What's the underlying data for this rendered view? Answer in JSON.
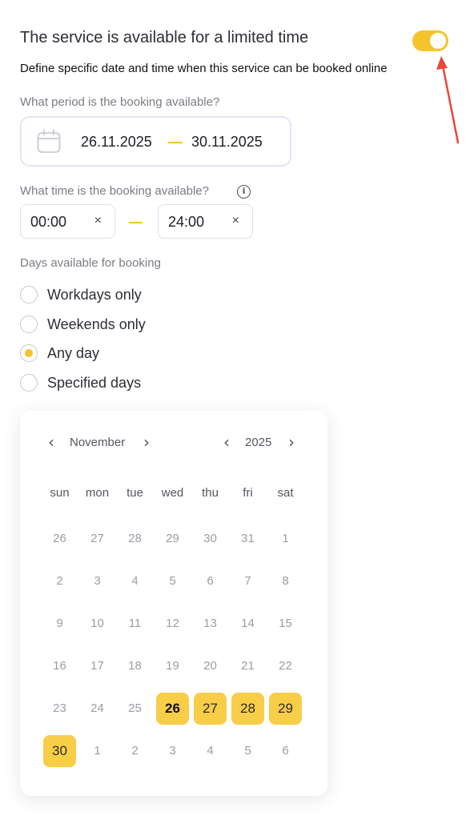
{
  "header": {
    "title": "The service is available for a limited time",
    "subtitle": "Define specific date and time when this service can be booked online",
    "toggle_on": true
  },
  "period": {
    "label": "What period is the booking available?",
    "start": "26.11.2025",
    "end": "30.11.2025",
    "icon": "calendar-icon"
  },
  "time": {
    "label": "What time is the booking available?",
    "info_icon": "i",
    "start": "00:00",
    "end": "24:00",
    "clear_symbol": "×"
  },
  "days": {
    "label": "Days available for booking",
    "options": [
      {
        "label": "Workdays only",
        "selected": false
      },
      {
        "label": "Weekends only",
        "selected": false
      },
      {
        "label": "Any day",
        "selected": true
      },
      {
        "label": "Specified days",
        "selected": false
      }
    ]
  },
  "calendar": {
    "month": "November",
    "year": "2025",
    "prev_symbol": "‹",
    "next_symbol": "›",
    "weekdays": [
      "sun",
      "mon",
      "tue",
      "wed",
      "thu",
      "fri",
      "sat"
    ],
    "weeks": [
      [
        "26",
        "27",
        "28",
        "29",
        "30",
        "31",
        "1"
      ],
      [
        "2",
        "3",
        "4",
        "5",
        "6",
        "7",
        "8"
      ],
      [
        "9",
        "10",
        "11",
        "12",
        "13",
        "14",
        "15"
      ],
      [
        "16",
        "17",
        "18",
        "19",
        "20",
        "21",
        "22"
      ],
      [
        "23",
        "24",
        "25",
        "26",
        "27",
        "28",
        "29"
      ],
      [
        "30",
        "1",
        "2",
        "3",
        "4",
        "5",
        "6"
      ]
    ],
    "selected_cells": [
      [
        4,
        3
      ],
      [
        4,
        4
      ],
      [
        4,
        5
      ],
      [
        4,
        6
      ],
      [
        5,
        0
      ]
    ],
    "range_start_cell": [
      4,
      3
    ]
  },
  "colors": {
    "accent": "#f5c42c",
    "selected_day": "#f8cd47",
    "annotation_arrow": "#e8473a"
  }
}
